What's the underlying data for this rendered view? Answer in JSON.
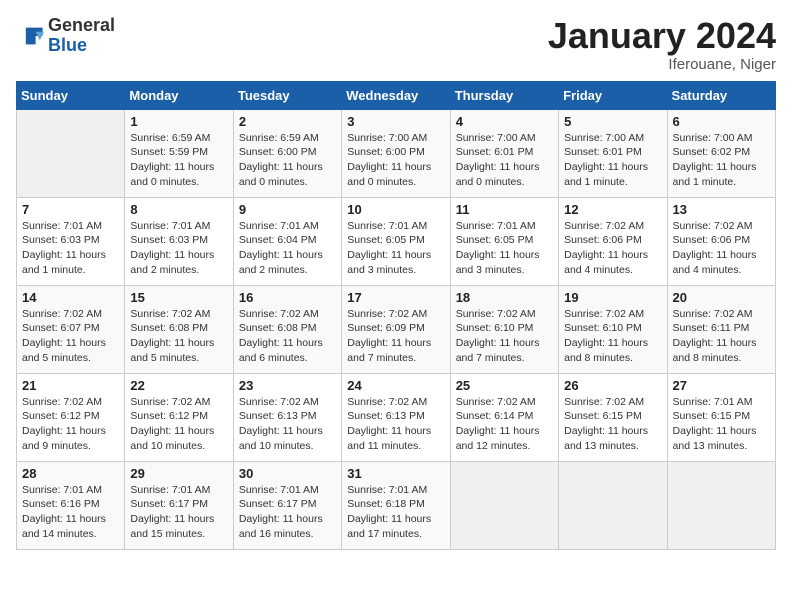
{
  "header": {
    "logo_general": "General",
    "logo_blue": "Blue",
    "month_title": "January 2024",
    "location": "Iferouane, Niger"
  },
  "calendar": {
    "days_of_week": [
      "Sunday",
      "Monday",
      "Tuesday",
      "Wednesday",
      "Thursday",
      "Friday",
      "Saturday"
    ],
    "weeks": [
      [
        {
          "day": "",
          "sunrise": "",
          "sunset": "",
          "daylight": ""
        },
        {
          "day": "1",
          "sunrise": "Sunrise: 6:59 AM",
          "sunset": "Sunset: 5:59 PM",
          "daylight": "Daylight: 11 hours and 0 minutes."
        },
        {
          "day": "2",
          "sunrise": "Sunrise: 6:59 AM",
          "sunset": "Sunset: 6:00 PM",
          "daylight": "Daylight: 11 hours and 0 minutes."
        },
        {
          "day": "3",
          "sunrise": "Sunrise: 7:00 AM",
          "sunset": "Sunset: 6:00 PM",
          "daylight": "Daylight: 11 hours and 0 minutes."
        },
        {
          "day": "4",
          "sunrise": "Sunrise: 7:00 AM",
          "sunset": "Sunset: 6:01 PM",
          "daylight": "Daylight: 11 hours and 0 minutes."
        },
        {
          "day": "5",
          "sunrise": "Sunrise: 7:00 AM",
          "sunset": "Sunset: 6:01 PM",
          "daylight": "Daylight: 11 hours and 1 minute."
        },
        {
          "day": "6",
          "sunrise": "Sunrise: 7:00 AM",
          "sunset": "Sunset: 6:02 PM",
          "daylight": "Daylight: 11 hours and 1 minute."
        }
      ],
      [
        {
          "day": "7",
          "sunrise": "Sunrise: 7:01 AM",
          "sunset": "Sunset: 6:03 PM",
          "daylight": "Daylight: 11 hours and 1 minute."
        },
        {
          "day": "8",
          "sunrise": "Sunrise: 7:01 AM",
          "sunset": "Sunset: 6:03 PM",
          "daylight": "Daylight: 11 hours and 2 minutes."
        },
        {
          "day": "9",
          "sunrise": "Sunrise: 7:01 AM",
          "sunset": "Sunset: 6:04 PM",
          "daylight": "Daylight: 11 hours and 2 minutes."
        },
        {
          "day": "10",
          "sunrise": "Sunrise: 7:01 AM",
          "sunset": "Sunset: 6:05 PM",
          "daylight": "Daylight: 11 hours and 3 minutes."
        },
        {
          "day": "11",
          "sunrise": "Sunrise: 7:01 AM",
          "sunset": "Sunset: 6:05 PM",
          "daylight": "Daylight: 11 hours and 3 minutes."
        },
        {
          "day": "12",
          "sunrise": "Sunrise: 7:02 AM",
          "sunset": "Sunset: 6:06 PM",
          "daylight": "Daylight: 11 hours and 4 minutes."
        },
        {
          "day": "13",
          "sunrise": "Sunrise: 7:02 AM",
          "sunset": "Sunset: 6:06 PM",
          "daylight": "Daylight: 11 hours and 4 minutes."
        }
      ],
      [
        {
          "day": "14",
          "sunrise": "Sunrise: 7:02 AM",
          "sunset": "Sunset: 6:07 PM",
          "daylight": "Daylight: 11 hours and 5 minutes."
        },
        {
          "day": "15",
          "sunrise": "Sunrise: 7:02 AM",
          "sunset": "Sunset: 6:08 PM",
          "daylight": "Daylight: 11 hours and 5 minutes."
        },
        {
          "day": "16",
          "sunrise": "Sunrise: 7:02 AM",
          "sunset": "Sunset: 6:08 PM",
          "daylight": "Daylight: 11 hours and 6 minutes."
        },
        {
          "day": "17",
          "sunrise": "Sunrise: 7:02 AM",
          "sunset": "Sunset: 6:09 PM",
          "daylight": "Daylight: 11 hours and 7 minutes."
        },
        {
          "day": "18",
          "sunrise": "Sunrise: 7:02 AM",
          "sunset": "Sunset: 6:10 PM",
          "daylight": "Daylight: 11 hours and 7 minutes."
        },
        {
          "day": "19",
          "sunrise": "Sunrise: 7:02 AM",
          "sunset": "Sunset: 6:10 PM",
          "daylight": "Daylight: 11 hours and 8 minutes."
        },
        {
          "day": "20",
          "sunrise": "Sunrise: 7:02 AM",
          "sunset": "Sunset: 6:11 PM",
          "daylight": "Daylight: 11 hours and 8 minutes."
        }
      ],
      [
        {
          "day": "21",
          "sunrise": "Sunrise: 7:02 AM",
          "sunset": "Sunset: 6:12 PM",
          "daylight": "Daylight: 11 hours and 9 minutes."
        },
        {
          "day": "22",
          "sunrise": "Sunrise: 7:02 AM",
          "sunset": "Sunset: 6:12 PM",
          "daylight": "Daylight: 11 hours and 10 minutes."
        },
        {
          "day": "23",
          "sunrise": "Sunrise: 7:02 AM",
          "sunset": "Sunset: 6:13 PM",
          "daylight": "Daylight: 11 hours and 10 minutes."
        },
        {
          "day": "24",
          "sunrise": "Sunrise: 7:02 AM",
          "sunset": "Sunset: 6:13 PM",
          "daylight": "Daylight: 11 hours and 11 minutes."
        },
        {
          "day": "25",
          "sunrise": "Sunrise: 7:02 AM",
          "sunset": "Sunset: 6:14 PM",
          "daylight": "Daylight: 11 hours and 12 minutes."
        },
        {
          "day": "26",
          "sunrise": "Sunrise: 7:02 AM",
          "sunset": "Sunset: 6:15 PM",
          "daylight": "Daylight: 11 hours and 13 minutes."
        },
        {
          "day": "27",
          "sunrise": "Sunrise: 7:01 AM",
          "sunset": "Sunset: 6:15 PM",
          "daylight": "Daylight: 11 hours and 13 minutes."
        }
      ],
      [
        {
          "day": "28",
          "sunrise": "Sunrise: 7:01 AM",
          "sunset": "Sunset: 6:16 PM",
          "daylight": "Daylight: 11 hours and 14 minutes."
        },
        {
          "day": "29",
          "sunrise": "Sunrise: 7:01 AM",
          "sunset": "Sunset: 6:17 PM",
          "daylight": "Daylight: 11 hours and 15 minutes."
        },
        {
          "day": "30",
          "sunrise": "Sunrise: 7:01 AM",
          "sunset": "Sunset: 6:17 PM",
          "daylight": "Daylight: 11 hours and 16 minutes."
        },
        {
          "day": "31",
          "sunrise": "Sunrise: 7:01 AM",
          "sunset": "Sunset: 6:18 PM",
          "daylight": "Daylight: 11 hours and 17 minutes."
        },
        {
          "day": "",
          "sunrise": "",
          "sunset": "",
          "daylight": ""
        },
        {
          "day": "",
          "sunrise": "",
          "sunset": "",
          "daylight": ""
        },
        {
          "day": "",
          "sunrise": "",
          "sunset": "",
          "daylight": ""
        }
      ]
    ]
  }
}
